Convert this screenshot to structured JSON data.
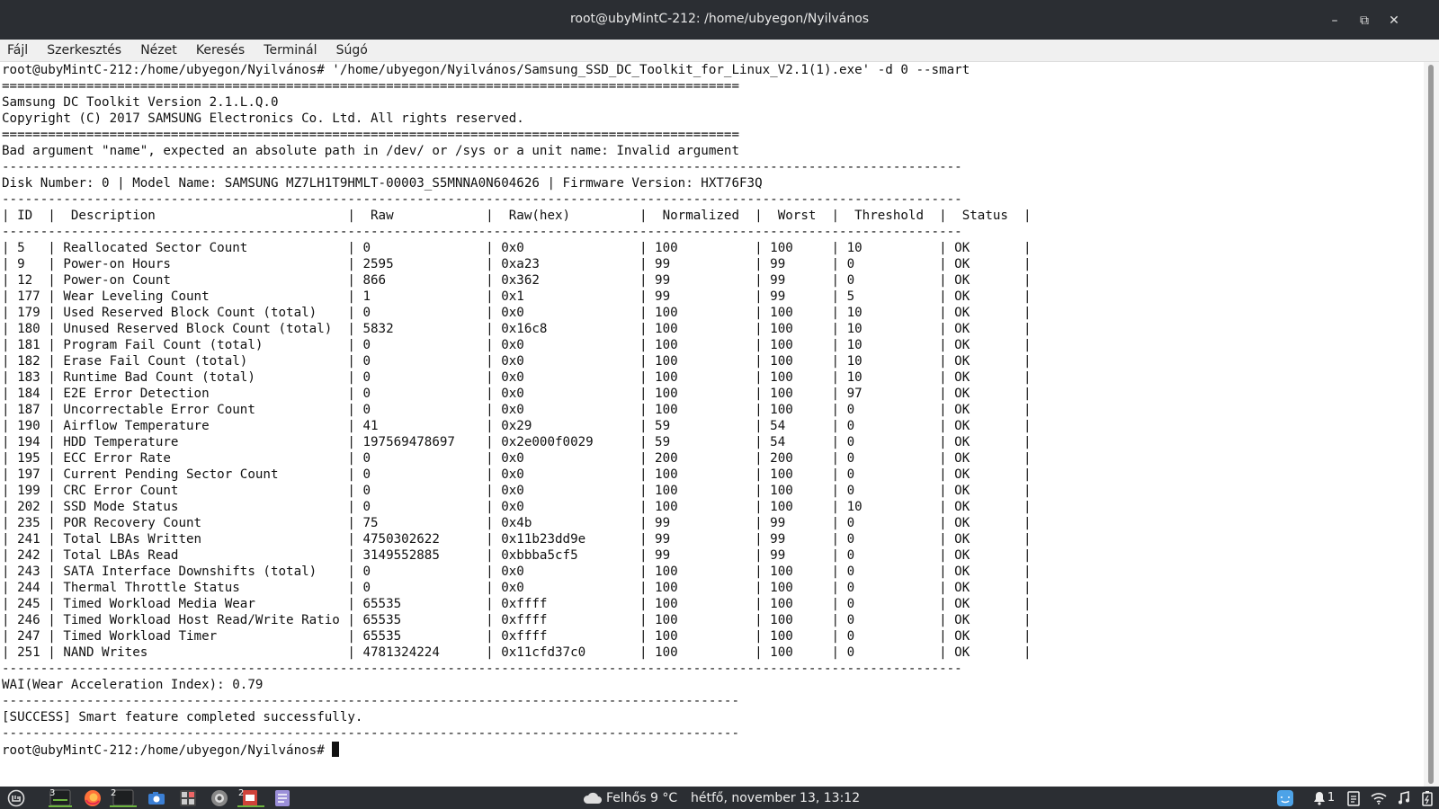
{
  "window": {
    "title": "root@ubyMintC-212: /home/ubyegon/Nyilvános",
    "buttons": {
      "minimize": "–",
      "restore": "⧉",
      "close": "✕"
    }
  },
  "menu": [
    "Fájl",
    "Szerkesztés",
    "Nézet",
    "Keresés",
    "Terminál",
    "Súgó"
  ],
  "terminal": {
    "lines": [
      "root@ubyMintC-212:/home/ubyegon/Nyilvános# '/home/ubyegon/Nyilvános/Samsung_SSD_DC_Toolkit_for_Linux_V2.1(1).exe' -d 0 --smart",
      "================================================================================================",
      "Samsung DC Toolkit Version 2.1.L.Q.0",
      "Copyright (C) 2017 SAMSUNG Electronics Co. Ltd. All rights reserved.",
      "================================================================================================",
      "Bad argument \"name\", expected an absolute path in /dev/ or /sys or a unit name: Invalid argument",
      "-----------------------------------------------------------------------------------------------------------------------------",
      "Disk Number: 0 | Model Name: SAMSUNG MZ7LH1T9HMLT-00003_S5MNNA0N604626 | Firmware Version: HXT76F3Q",
      "-----------------------------------------------------------------------------------------------------------------------------",
      "| ID  |  Description                         |  Raw            |  Raw(hex)         |  Normalized  |  Worst  |  Threshold  |  Status  |",
      "-----------------------------------------------------------------------------------------------------------------------------",
      "| 5   | Reallocated Sector Count             | 0               | 0x0               | 100          | 100     | 10          | OK       |",
      "| 9   | Power-on Hours                       | 2595            | 0xa23             | 99           | 99      | 0           | OK       |",
      "| 12  | Power-on Count                       | 866             | 0x362             | 99           | 99      | 0           | OK       |",
      "| 177 | Wear Leveling Count                  | 1               | 0x1               | 99           | 99      | 5           | OK       |",
      "| 179 | Used Reserved Block Count (total)    | 0               | 0x0               | 100          | 100     | 10          | OK       |",
      "| 180 | Unused Reserved Block Count (total)  | 5832            | 0x16c8            | 100          | 100     | 10          | OK       |",
      "| 181 | Program Fail Count (total)           | 0               | 0x0               | 100          | 100     | 10          | OK       |",
      "| 182 | Erase Fail Count (total)             | 0               | 0x0               | 100          | 100     | 10          | OK       |",
      "| 183 | Runtime Bad Count (total)            | 0               | 0x0               | 100          | 100     | 10          | OK       |",
      "| 184 | E2E Error Detection                  | 0               | 0x0               | 100          | 100     | 97          | OK       |",
      "| 187 | Uncorrectable Error Count            | 0               | 0x0               | 100          | 100     | 0           | OK       |",
      "| 190 | Airflow Temperature                  | 41              | 0x29              | 59           | 54      | 0           | OK       |",
      "| 194 | HDD Temperature                      | 197569478697    | 0x2e000f0029      | 59           | 54      | 0           | OK       |",
      "| 195 | ECC Error Rate                       | 0               | 0x0               | 200          | 200     | 0           | OK       |",
      "| 197 | Current Pending Sector Count         | 0               | 0x0               | 100          | 100     | 0           | OK       |",
      "| 199 | CRC Error Count                      | 0               | 0x0               | 100          | 100     | 0           | OK       |",
      "| 202 | SSD Mode Status                      | 0               | 0x0               | 100          | 100     | 10          | OK       |",
      "| 235 | POR Recovery Count                   | 75              | 0x4b              | 99           | 99      | 0           | OK       |",
      "| 241 | Total LBAs Written                   | 4750302622      | 0x11b23dd9e       | 99           | 99      | 0           | OK       |",
      "| 242 | Total LBAs Read                      | 3149552885      | 0xbbba5cf5        | 99           | 99      | 0           | OK       |",
      "| 243 | SATA Interface Downshifts (total)    | 0               | 0x0               | 100          | 100     | 0           | OK       |",
      "| 244 | Thermal Throttle Status              | 0               | 0x0               | 100          | 100     | 0           | OK       |",
      "| 245 | Timed Workload Media Wear            | 65535           | 0xffff            | 100          | 100     | 0           | OK       |",
      "| 246 | Timed Workload Host Read/Write Ratio | 65535           | 0xffff            | 100          | 100     | 0           | OK       |",
      "| 247 | Timed Workload Timer                 | 65535           | 0xffff            | 100          | 100     | 0           | OK       |",
      "| 251 | NAND Writes                          | 4781324224      | 0x11cfd37c0       | 100          | 100     | 0           | OK       |",
      "-----------------------------------------------------------------------------------------------------------------------------",
      "WAI(Wear Acceleration Index): 0.79",
      "------------------------------------------------------------------------------------------------",
      "[SUCCESS] Smart feature completed successfully.",
      "------------------------------------------------------------------------------------------------"
    ],
    "prompt": "root@ubyMintC-212:/home/ubyegon/Nyilvános# "
  },
  "taskbar": {
    "workspace_badge": "3",
    "firefox_badge": "2",
    "impress_badge": "2",
    "weather": "Felhős 9 °C",
    "datetime": "hétfő, november 13, 13:12",
    "notifications": "1",
    "icons": [
      "mint-menu-icon",
      "terminal-icon",
      "firefox-icon",
      "window-list-icon",
      "camera-icon",
      "calculator-icon",
      "screenshot-icon",
      "impress-icon",
      "text-editor-icon"
    ]
  },
  "colors": {
    "titlebar": "#2b2e33",
    "accent": "#6bb33e",
    "terminal_bg": "#ffffff"
  }
}
